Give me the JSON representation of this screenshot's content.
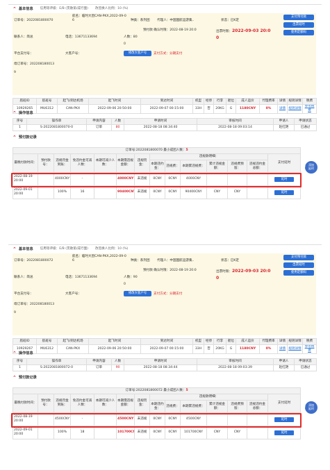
{
  "panels": [
    {
      "section_basic": {
        "title": "基本信息",
        "sub1": "信用等评级：E/B (贯散第/成行面)",
        "sub2": "改签换人比例：10 (%)"
      },
      "order_no": "订单号：2022081800070",
      "route": "航名：临时大因CAN-PKX,2022-09-0\n6",
      "type": "种类：系列团",
      "agent": "代理人：中国国航运游集..",
      "status": "状态：已K定",
      "contact": "联系人：简总",
      "phone": "电话：13671133694",
      "people_label": "人数：",
      "people_val": "80",
      "pay_label": "预付款 确认时限：",
      "pay_time": "2022-08-19 20:0",
      "pay_zero": "0",
      "ticket_label": "出票时限：",
      "ticket_time": "2022-09-03 20:0",
      "ticket_zero": "0",
      "platform": "平台支付号：",
      "customer": "大客户号：",
      "btn_change_customer": "修改大客户号",
      "pay_method_label": "支付方式：",
      "pay_method": "分期支付",
      "mother_order": "母订单号：202208180013\n9",
      "buttons": [
        "支付预付款",
        "出票延时",
        "使用定额码"
      ],
      "flight_headers": [
        "航班ID",
        "航班号",
        "起飞/到达机场",
        "起飞时间",
        "到达时间",
        "机型",
        "经停",
        "行李",
        "舱位",
        "成人运价",
        "代理费率",
        "详情",
        "规则详情",
        "税费"
      ],
      "flight_row": {
        "id": "10929265",
        "no": "MU6312",
        "airport": "CAN-PKX",
        "dep": "2022-09-06 20:50:00",
        "arr": "2022-09-07 00:15:00",
        "model": "33H",
        "stop": "否",
        "bag": "20KG",
        "cabin": "G",
        "fare": "1180CNY",
        "rate": "0%",
        "detail": "详情",
        "rule": "规则详情",
        "tax": "参考税费"
      },
      "section_ops": {
        "title": "操作信息"
      },
      "ops_headers": [
        "序号",
        "操作单",
        "申请内容",
        "人数",
        "申请时间",
        "审核时间",
        "申请人",
        "申请状态"
      ],
      "ops_row": {
        "no": "1",
        "doc": "S-2022081800070-0",
        "content": "订单",
        "num": "80",
        "apply": "2022-08-18 08:34:40",
        "review": "2022-08-18 09:03:14",
        "applicant": "赵红艳",
        "state": "已通过"
      },
      "section_pre": {
        "title": "预付款记录"
      },
      "pre_header": "订单号:2022081800070 最小成团人数：",
      "pre_min": "5",
      "pre_cols": [
        "最晚付款时间：",
        "预付款号：",
        "违规罚金到账：",
        "免违约金可减人数：",
        "本期可减少人数：",
        "本期需违规金额：",
        "违规罚金：",
        "本期违约金：",
        "违规费：",
        "本期累违规费：",
        "累计违规金额：",
        "违规费预留：",
        "违规违约金总额：",
        "支付延时"
      ],
      "pre_group": "违规款明细：",
      "pre_rows": [
        {
          "deadline": "2022-08-19\n20:00",
          "rate": "4000CNY",
          "reduce": "-",
          "amount": "4000CNY",
          "status": "未违规",
          "c1": "0CNY",
          "c2": "0CNY",
          "c3": "4000CNY",
          "c4": "",
          "c5": "",
          "c6": "",
          "btn": "延时"
        },
        {
          "deadline": "2022-09-01\n20:00",
          "rate": "100%",
          "reduce": "16",
          "amount": "90400CNY",
          "status": "未违规",
          "c1": "0CNY",
          "c2": "0CNY",
          "c3": "90400CNY",
          "c4": "CNY",
          "c5": "CNY",
          "c6": "",
          "btn": "延时"
        }
      ],
      "bubble": "添加\n延时"
    },
    {
      "section_basic": {
        "title": "基本信息",
        "sub1": "信用等评级：E/B (贯散第/成行面)",
        "sub2": "改签换人比例：10 (%)"
      },
      "order_no": "订单号：2022081800072",
      "route": "航名：临时大因CAN-PKX,2022-09-0\n6",
      "type": "种类：系列团",
      "agent": "代理人：中国国航运游集..",
      "status": "状态：已K定",
      "contact": "联系人：简总",
      "phone": "电话：13671133694",
      "people_label": "人数：",
      "people_val": "90",
      "pay_label": "预付款 确认时限：",
      "pay_time": "2022-08-19 20:0",
      "pay_zero": "0",
      "ticket_label": "出票时限：",
      "ticket_time": "2022-09-03 20:0",
      "ticket_zero": "0",
      "platform": "平台支付号：",
      "customer": "大客户号：",
      "btn_change_customer": "修改大客户号",
      "pay_method_label": "支付方式：",
      "pay_method": "分期支付",
      "mother_order": "母订单号：202208180013\n9",
      "buttons": [
        "支付预付款",
        "出票延时",
        "使用定额码"
      ],
      "flight_headers": [
        "航班ID",
        "航班号",
        "起飞/到达机场",
        "起飞时间",
        "到达时间",
        "机型",
        "经停",
        "行李",
        "舱位",
        "成人运价",
        "代理费率",
        "详情",
        "规则详情",
        "税费"
      ],
      "flight_row": {
        "id": "10929267",
        "no": "MU6312",
        "airport": "CAN-PKX",
        "dep": "2022-09-06 20:50:00",
        "arr": "2022-09-07 00:15:00",
        "model": "33H",
        "stop": "否",
        "bag": "20KG",
        "cabin": "G",
        "fare": "1180CNY",
        "rate": "0%",
        "detail": "详情",
        "rule": "规则详情",
        "tax": "参考税费"
      },
      "section_ops": {
        "title": "操作信息"
      },
      "ops_headers": [
        "序号",
        "操作单",
        "申请内容",
        "人数",
        "申请时间",
        "审核时间",
        "申请人",
        "申请状态"
      ],
      "ops_row": {
        "no": "1",
        "doc": "S-2022081800072-0",
        "content": "订单",
        "num": "90",
        "apply": "2022-08-18 08:34:44",
        "review": "2022-08-18 09:03:39",
        "applicant": "赵红艳",
        "state": "已通过"
      },
      "section_pre": {
        "title": "预付款记录"
      },
      "pre_header": "订单号:2022081800072 最小成团人数：",
      "pre_min": "5",
      "pre_cols": [
        "最晚付款时间：",
        "预付款号：",
        "违规罚金到账：",
        "免违约金可减人数：",
        "本期可减少人数：",
        "本期需违规金额：",
        "违规罚金：",
        "本期违约金：",
        "违规费：",
        "本期累违规费：",
        "累计违规金额：",
        "违规费预留：",
        "违规违约金总额：",
        "支付延时"
      ],
      "pre_group": "违规款明细：",
      "pre_rows": [
        {
          "deadline": "2022-08-19\n20:00",
          "rate": "4500CNY",
          "reduce": "-",
          "amount": "4500CNY",
          "status": "未违规",
          "c1": "0CNY",
          "c2": "0CNY",
          "c3": "4500CNY",
          "c4": "",
          "c5": "",
          "c6": "",
          "btn": "延时"
        },
        {
          "deadline": "2022-09-01\n20:00",
          "rate": "100%",
          "reduce": "18",
          "amount": "101700CNY",
          "status": "未违规",
          "c1": "0CNY",
          "c2": "0CNY",
          "c3": "101700CNY",
          "c4": "CNY",
          "c5": "CNY",
          "c6": "",
          "btn": "延时"
        }
      ],
      "bubble": "添加\n延时"
    }
  ]
}
